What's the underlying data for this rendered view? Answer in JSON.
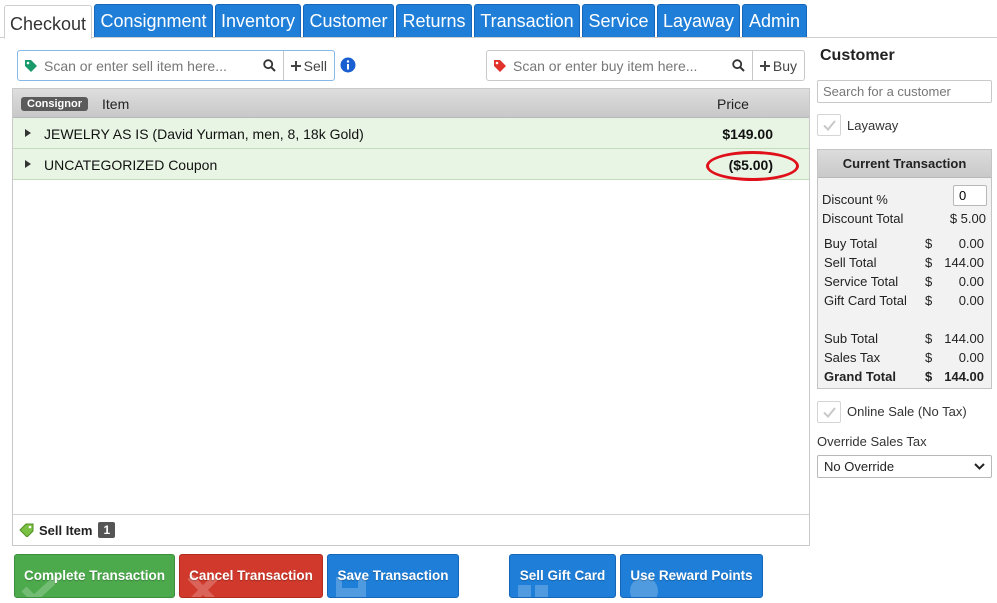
{
  "tabs": [
    {
      "label": "Checkout",
      "active": true
    },
    {
      "label": "Consignment"
    },
    {
      "label": "Inventory"
    },
    {
      "label": "Customer"
    },
    {
      "label": "Returns"
    },
    {
      "label": "Transaction"
    },
    {
      "label": "Service"
    },
    {
      "label": "Layaway"
    },
    {
      "label": "Admin"
    }
  ],
  "sell_scan": {
    "placeholder": "Scan or enter sell item here...",
    "action_label": "Sell"
  },
  "buy_scan": {
    "placeholder": "Scan or enter buy item here...",
    "action_label": "Buy"
  },
  "cart": {
    "consignor_badge": "Consignor",
    "col_item": "Item",
    "col_price": "Price",
    "rows": [
      {
        "name": "JEWELRY AS IS (David Yurman, men, 8, 18k Gold)",
        "price": "$149.00"
      },
      {
        "name": "UNCATEGORIZED Coupon",
        "price": "($5.00)"
      }
    ],
    "footer_label": "Sell Item",
    "footer_count": "1"
  },
  "buttons": {
    "complete": "Complete Transaction",
    "cancel": "Cancel Transaction",
    "save": "Save Transaction",
    "gift": "Sell Gift Card",
    "reward": "Use Reward Points"
  },
  "customer": {
    "title": "Customer",
    "search_placeholder": "Search for a customer",
    "layaway_label": "Layaway"
  },
  "current_transaction": {
    "title": "Current Transaction",
    "discount_pct_label": "Discount %",
    "discount_pct_value": "0",
    "discount_total_label": "Discount Total",
    "discount_total_value": "$ 5.00",
    "currency": "$",
    "lines": [
      {
        "label": "Buy Total",
        "value": "0.00"
      },
      {
        "label": "Sell Total",
        "value": "144.00"
      },
      {
        "label": "Service Total",
        "value": "0.00"
      },
      {
        "label": "Gift Card Total",
        "value": "0.00"
      }
    ],
    "totals": [
      {
        "label": "Sub Total",
        "value": "144.00"
      },
      {
        "label": "Sales Tax",
        "value": "0.00"
      },
      {
        "label": "Grand Total",
        "value": "144.00"
      }
    ]
  },
  "online_sale_label": "Online Sale (No Tax)",
  "override": {
    "label": "Override Sales Tax",
    "selected": "No Override"
  },
  "colors": {
    "tab_blue": "#1f7fd8",
    "row_green": "#e8f5e4",
    "complete_green": "#4caa4c",
    "cancel_red": "#d0392b",
    "highlight_red": "#e0101a"
  }
}
